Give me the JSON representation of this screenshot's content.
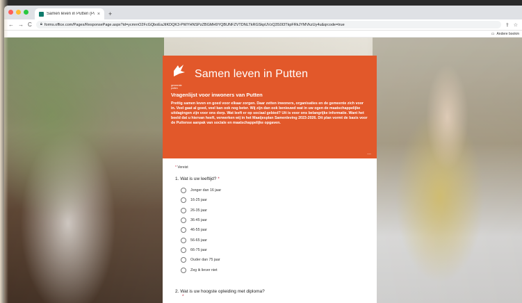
{
  "browser": {
    "tab_title": "Samen leven in Putten (Pagin",
    "tab_close": "×",
    "new_tab": "+",
    "url": "forms.office.com/Pages/ResponsePage.aspx?id=ycmrnO2FcGQboEaJiIKDQK3-PWYHNSPzZBGMH9YQBUNFZVTDNLTkRGSkpUVzQ3S0I3TkpFRkJYMVkzUy4u&qrcode=true",
    "bookmark_label": "Andere bookm",
    "nav_back": "←",
    "nav_forward": "→",
    "nav_reload": "C"
  },
  "form": {
    "logo_text": "gemeente putten",
    "title": "Samen leven in Putten",
    "subtitle": "Vragenlijst voor inwoners van Putten",
    "intro": "Prettig samen leven en goed voor elkaar zorgen. Daar zetten inwoners, organisaties en de gemeente zich voor in. Veel gaat al goed, veel kan ook nog beter. Wij zijn dan ook benieuwd wat in uw ogen de maatschappelijke uitdagingen zijn voor ons dorp. Wat leeft er op sociaal gebied? Uit is voor ons belangrijke informatie. Want het beeld dat u hiervan heeft, verwerken wij in het Maatjesplan Samenleving 2023-2026. Dit plan vormt de basis voor de Puttense aanpak van sociale en maatschappelijke opgaven.",
    "more": "...",
    "required_label": "Vereist",
    "required_star": "*",
    "q1_label": "1. Wat is uw leeftijd?",
    "q1_options": [
      "Jonger dan 16 jaar",
      "16-25 jaar",
      "26-35 jaar",
      "36-45 jaar",
      "46-55 jaar",
      "56-65 jaar",
      "66-75 jaar",
      "Ouder dan 75 jaar",
      "Zeg ik liever niet"
    ],
    "q2_label": "2. Wat is uw hoogste opleiding met diploma?"
  },
  "colors": {
    "accent": "#e2582a",
    "required": "#c4314b"
  }
}
